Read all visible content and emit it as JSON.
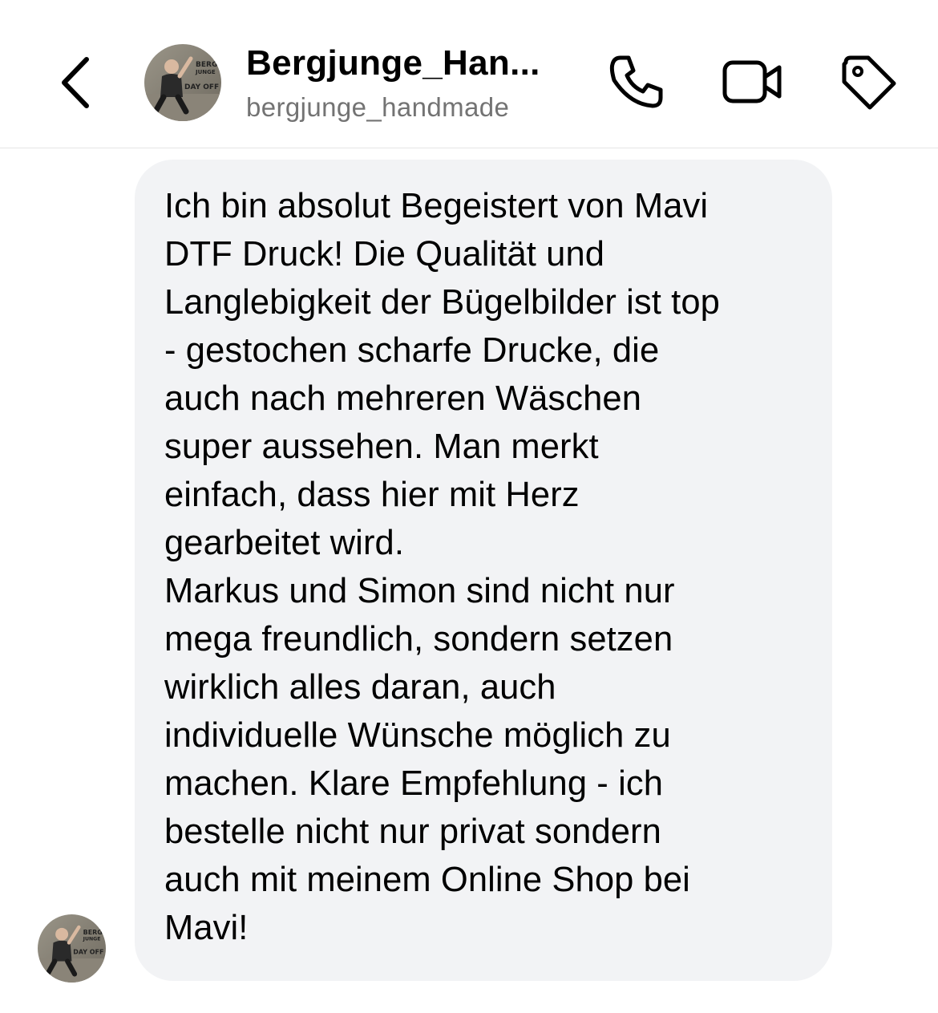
{
  "header": {
    "title": "Bergjunge_Han...",
    "subtitle": "bergjunge_handmade",
    "avatar_text": [
      "BERG",
      "JUNGE",
      "DAY OFF"
    ],
    "icons": {
      "back": "chevron-left-icon",
      "call": "phone-icon",
      "video": "video-camera-icon",
      "tag": "tag-icon"
    }
  },
  "message": {
    "paragraph_1": "Ich bin absolut Begeistert von Mavi\nDTF Druck! Die Qualität und\nLanglebigkeit der Bügelbilder ist top\n- gestochen scharfe Drucke, die\nauch nach mehreren Wäschen\nsuper aussehen. Man merkt\neinfach, dass hier mit Herz\ngearbeitet wird.",
    "paragraph_2": "Markus und Simon sind nicht nur\nmega freundlich, sondern setzen\nwirklich alles daran, auch\nindividuelle Wünsche möglich zu\nmachen. Klare Empfehlung - ich\nbestelle nicht nur privat sondern\nauch mit meinem Online Shop bei\nMavi!"
  },
  "colors": {
    "bubble": "#f2f3f5",
    "subtitle": "#737373",
    "divider": "#e6e6e6"
  }
}
